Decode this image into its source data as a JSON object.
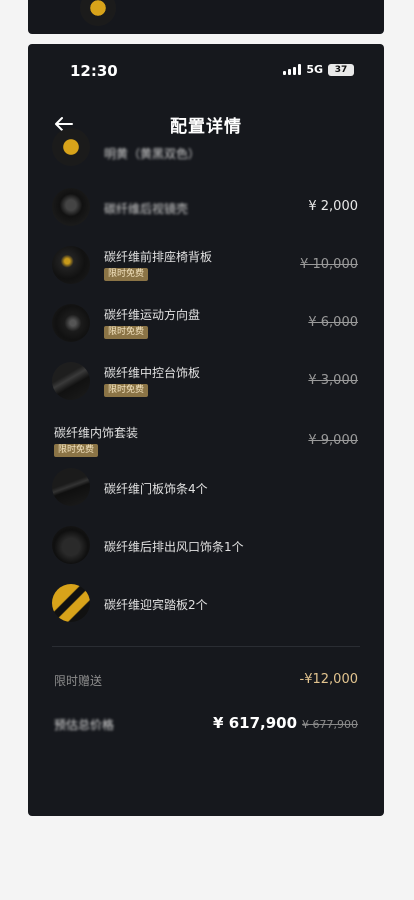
{
  "status_bar": {
    "time": "12:30",
    "network": "5G",
    "battery": "37"
  },
  "header": {
    "title": "配置详情",
    "back_icon": "arrow-left-icon"
  },
  "items": [
    {
      "name": "明黄（黄黑双色）",
      "price": "",
      "badge": ""
    },
    {
      "name": "碳纤维后视镜壳",
      "price": "¥ 2,000",
      "badge": ""
    },
    {
      "name": "碳纤维前排座椅背板",
      "price": "¥ 10,000",
      "badge": "限时免费"
    },
    {
      "name": "碳纤维运动方向盘",
      "price": "¥ 6,000",
      "badge": "限时免费"
    },
    {
      "name": "碳纤维中控台饰板",
      "price": "¥ 3,000",
      "badge": "限时免费"
    },
    {
      "name": "碳纤维内饰套装",
      "price": "¥ 9,000",
      "badge": "限时免费"
    },
    {
      "name": "碳纤维门板饰条4个",
      "price": "",
      "badge": ""
    },
    {
      "name": "碳纤维后排出风口饰条1个",
      "price": "",
      "badge": ""
    },
    {
      "name": "碳纤维迎宾踏板2个",
      "price": "",
      "badge": ""
    }
  ],
  "summary": {
    "gift_label": "限时赠送",
    "gift_value": "-¥12,000",
    "total_label": "预估总价格",
    "total_price": "¥ 617,900",
    "original_price": "¥ 677,900"
  }
}
